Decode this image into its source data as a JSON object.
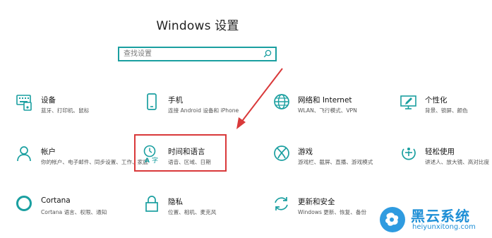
{
  "window": {
    "title": "Windows 设置"
  },
  "search": {
    "placeholder": "查找设置",
    "icon": "search-icon"
  },
  "accent_color": "#1a9fa0",
  "annotation_color": "#d9393a",
  "tiles": [
    {
      "id": "devices",
      "icon": "keyboard-icon",
      "name": "设备",
      "desc": "蓝牙、打印机、鼠标"
    },
    {
      "id": "phone",
      "icon": "phone-icon",
      "name": "手机",
      "desc": "连接 Android 设备和 iPhone"
    },
    {
      "id": "network",
      "icon": "globe-icon",
      "name": "网络和 Internet",
      "desc": "WLAN、飞行模式、VPN"
    },
    {
      "id": "personalization",
      "icon": "paintbrush-icon",
      "name": "个性化",
      "desc": "背景、锁屏、颜色"
    },
    {
      "id": "accounts",
      "icon": "person-icon",
      "name": "帐户",
      "desc": "你的帐户、电子邮件、同步设置、工作、家庭"
    },
    {
      "id": "time-language",
      "icon": "time-language-icon",
      "name": "时间和语言",
      "desc": "语音、区域、日期"
    },
    {
      "id": "gaming",
      "icon": "xbox-icon",
      "name": "游戏",
      "desc": "游戏栏、截屏、直播、游戏模式"
    },
    {
      "id": "ease-of-access",
      "icon": "ease-of-access-icon",
      "name": "轻松使用",
      "desc": "讲述人、放大镜、高对比度"
    },
    {
      "id": "cortana",
      "icon": "cortana-icon",
      "name": "Cortana",
      "desc": "Cortana 语言、权限、通知"
    },
    {
      "id": "privacy",
      "icon": "lock-icon",
      "name": "隐私",
      "desc": "位置、相机、麦克风"
    },
    {
      "id": "update-security",
      "icon": "refresh-icon",
      "name": "更新和安全",
      "desc": "Windows 更新、恢复、备份"
    }
  ],
  "watermark": {
    "name": "黑云系统",
    "url": "heiyunxitong.com",
    "color": "#1e8fd6"
  }
}
